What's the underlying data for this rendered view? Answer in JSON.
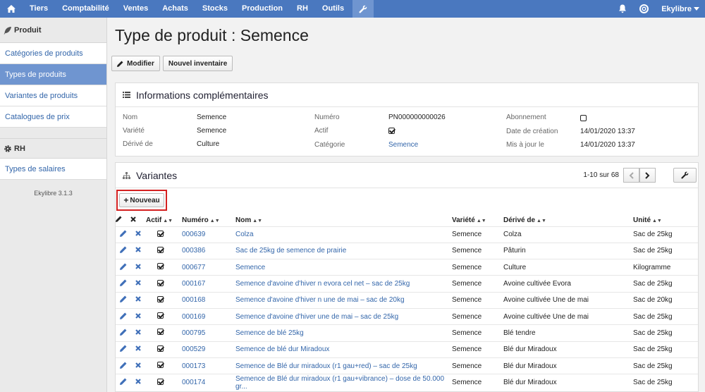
{
  "topbar": {
    "items": [
      "Tiers",
      "Comptabilité",
      "Ventes",
      "Achats",
      "Stocks",
      "Production",
      "RH",
      "Outils"
    ],
    "user": "Ekylibre"
  },
  "sidebar": {
    "section_produit": "Produit",
    "produit_items": [
      "Catégories de produits",
      "Types de produits",
      "Variantes de produits",
      "Catalogues de prix"
    ],
    "active_index": 1,
    "section_rh": "RH",
    "rh_items": [
      "Types de salaires"
    ],
    "version": "Ekylibre 3.1.3"
  },
  "page": {
    "title": "Type de produit : Semence",
    "buttons": {
      "modifier": "Modifier",
      "nouvel_inventaire": "Nouvel inventaire"
    }
  },
  "info": {
    "title": "Informations complémentaires",
    "nom_label": "Nom",
    "nom_value": "Semence",
    "variete_label": "Variété",
    "variete_value": "Semence",
    "derive_label": "Dérivé de",
    "derive_value": "Culture",
    "numero_label": "Numéro",
    "numero_value": "PN000000000026",
    "actif_label": "Actif",
    "actif_checked": true,
    "categorie_label": "Catégorie",
    "categorie_value": "Semence",
    "abonnement_label": "Abonnement",
    "abonnement_checked": false,
    "creation_label": "Date de création",
    "creation_value": "14/01/2020 13:37",
    "maj_label": "Mis à jour le",
    "maj_value": "14/01/2020 13:37"
  },
  "variantes": {
    "title": "Variantes",
    "pager_text": "1-10 sur 68",
    "new_button": "Nouveau",
    "columns": {
      "actif": "Actif",
      "numero": "Numéro",
      "nom": "Nom",
      "variete": "Variété",
      "derive": "Dérivé de",
      "unite": "Unité"
    },
    "rows": [
      {
        "numero": "000639",
        "nom": "Colza",
        "variete": "Semence",
        "derive": "Colza",
        "unite": "Sac de 25kg"
      },
      {
        "numero": "000386",
        "nom": "Sac de 25kg de semence de prairie",
        "variete": "Semence",
        "derive": "Pâturin",
        "unite": "Sac de 25kg"
      },
      {
        "numero": "000677",
        "nom": "Semence",
        "variete": "Semence",
        "derive": "Culture",
        "unite": "Kilogramme"
      },
      {
        "numero": "000167",
        "nom": "Semence d'avoine d'hiver n evora cel net – sac de 25kg",
        "variete": "Semence",
        "derive": "Avoine cultivée Evora",
        "unite": "Sac de 25kg"
      },
      {
        "numero": "000168",
        "nom": "Semence d'avoine d'hiver n une de mai – sac de 20kg",
        "variete": "Semence",
        "derive": "Avoine cultivée Une de mai",
        "unite": "Sac de 20kg"
      },
      {
        "numero": "000169",
        "nom": "Semence d'avoine d'hiver une de mai – sac de 25kg",
        "variete": "Semence",
        "derive": "Avoine cultivée Une de mai",
        "unite": "Sac de 25kg"
      },
      {
        "numero": "000795",
        "nom": "Semence de blé 25kg",
        "variete": "Semence",
        "derive": "Blé tendre",
        "unite": "Sac de 25kg"
      },
      {
        "numero": "000529",
        "nom": "Semence de blé dur Miradoux",
        "variete": "Semence",
        "derive": "Blé dur Miradoux",
        "unite": "Sac de 25kg"
      },
      {
        "numero": "000173",
        "nom": "Semence de Blé dur miradoux (r1 gau+red) – sac de 25kg",
        "variete": "Semence",
        "derive": "Blé dur Miradoux",
        "unite": "Sac de 25kg"
      },
      {
        "numero": "000174",
        "nom": "Semence de Blé dur miradoux (r1 gau+vibrance) – dose de 50.000 gr...",
        "variete": "Semence",
        "derive": "Blé dur Miradoux",
        "unite": "Sac de 25kg"
      }
    ]
  }
}
